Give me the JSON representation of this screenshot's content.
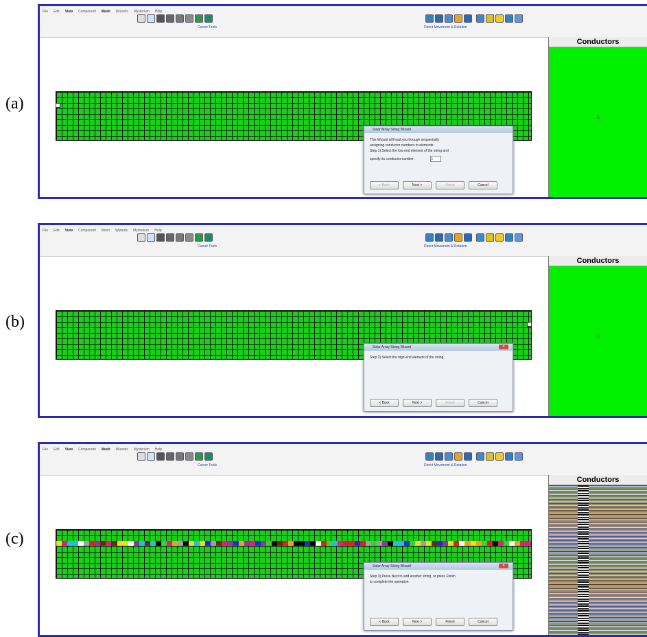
{
  "panels": [
    {
      "label": "(a)",
      "menu": [
        "File",
        "Edit",
        "View",
        "Component",
        "Mesh",
        "Wizards",
        "Mysterium",
        "Help"
      ],
      "cursor_tools_caption": "Cursor Tools",
      "direct_caption": "Direct Movement & Rotation",
      "conductors_header": "Conductors",
      "conductor_value": "1",
      "dialog": {
        "title": "Solar Array String Wizard",
        "lines": [
          "This Wizard will lead you through sequentially",
          "assigning conductor numbers to elements.",
          "Step 1) Select the low end element of the string and",
          "specify its conductor number:"
        ],
        "input_value": "1",
        "buttons": [
          "< Back",
          "Next >",
          "Finish",
          "Cancel"
        ],
        "disabled": [
          true,
          false,
          true,
          false
        ]
      }
    },
    {
      "label": "(b)",
      "menu": [
        "File",
        "Edit",
        "View",
        "Component",
        "Mesh",
        "Wizards",
        "Mysterium",
        "Help"
      ],
      "cursor_tools_caption": "Cursor Tools",
      "direct_caption": "Direct Movement & Rotation",
      "conductors_header": "Conductors",
      "conductor_value": "1",
      "dialog": {
        "title": "Solar Array String Wizard",
        "lines": [
          "Step 2) Select the high-end element of the string."
        ],
        "buttons": [
          "< Back",
          "Next >",
          "Finish",
          "Cancel"
        ],
        "disabled": [
          false,
          false,
          true,
          false
        ]
      }
    },
    {
      "label": "(c)",
      "menu": [
        "File",
        "Edit",
        "View",
        "Component",
        "Mesh",
        "Wizards",
        "Mysterium",
        "Help"
      ],
      "cursor_tools_caption": "Cursor Tools",
      "direct_caption": "Direct Movement & Rotation",
      "conductors_header": "Conductors",
      "dialog": {
        "title": "Solar Array String Wizard",
        "lines": [
          "Step 3) Press Next to add another string, or press Finish",
          "to complete the operation."
        ],
        "buttons": [
          "< Back",
          "Next >",
          "Finish",
          "Cancel"
        ],
        "disabled": [
          false,
          false,
          false,
          false
        ]
      }
    }
  ],
  "colors": {
    "frame_border": "#2a2ab4",
    "grid_green": "#19cf19",
    "conductor_green": "#00f000"
  }
}
